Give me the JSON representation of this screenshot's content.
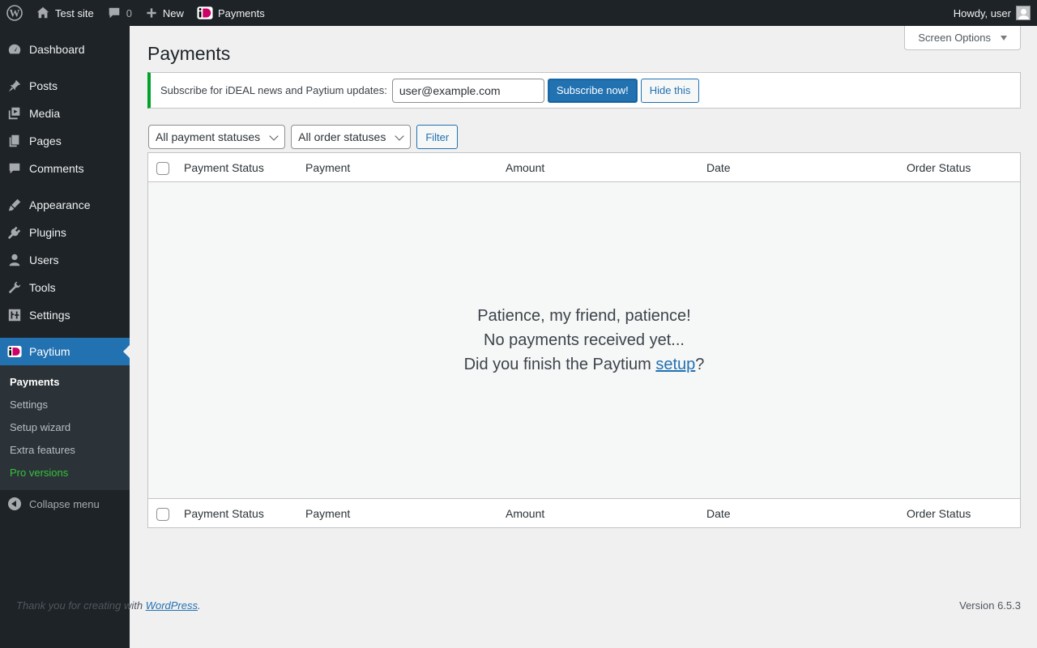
{
  "adminbar": {
    "site_name": "Test site",
    "comments_count": "0",
    "new_label": "New",
    "payments_label": "Payments",
    "howdy": "Howdy, user"
  },
  "sidebar": {
    "items": [
      {
        "label": "Dashboard",
        "icon": "dashboard-icon"
      },
      {
        "label": "Posts",
        "icon": "pin-icon"
      },
      {
        "label": "Media",
        "icon": "media-icon"
      },
      {
        "label": "Pages",
        "icon": "pages-icon"
      },
      {
        "label": "Comments",
        "icon": "comment-icon"
      },
      {
        "label": "Appearance",
        "icon": "brush-icon"
      },
      {
        "label": "Plugins",
        "icon": "plug-icon"
      },
      {
        "label": "Users",
        "icon": "user-icon"
      },
      {
        "label": "Tools",
        "icon": "wrench-icon"
      },
      {
        "label": "Settings",
        "icon": "settings-icon"
      },
      {
        "label": "Paytium",
        "icon": "ideal-icon"
      }
    ],
    "submenu": [
      "Payments",
      "Settings",
      "Setup wizard",
      "Extra features",
      "Pro versions"
    ],
    "collapse_label": "Collapse menu"
  },
  "main": {
    "screen_options": "Screen Options",
    "title": "Payments",
    "notice": {
      "text": "Subscribe for iDEAL news and Paytium updates:",
      "email_value": "user@example.com",
      "subscribe_label": "Subscribe now!",
      "hide_label": "Hide this"
    },
    "filters": {
      "payment_status": "All payment statuses",
      "order_status": "All order statuses",
      "filter_label": "Filter"
    },
    "table": {
      "columns": [
        "Payment Status",
        "Payment",
        "Amount",
        "Date",
        "Order Status"
      ],
      "empty_line1": "Patience, my friend, patience!",
      "empty_line2": "No payments received yet...",
      "empty_line3_pre": "Did you finish the Paytium ",
      "empty_line3_link": "setup",
      "empty_line3_post": "?"
    }
  },
  "footer": {
    "thanks_pre": "Thank you for creating with ",
    "thanks_link": "WordPress",
    "thanks_post": ".",
    "version": "Version 6.5.3"
  },
  "colors": {
    "accent": "#2271b1",
    "sidebar_bg": "#1d2327",
    "notice_border": "#00a32a",
    "pro_green": "#34c33b",
    "ideal_pink": "#cc0066"
  }
}
